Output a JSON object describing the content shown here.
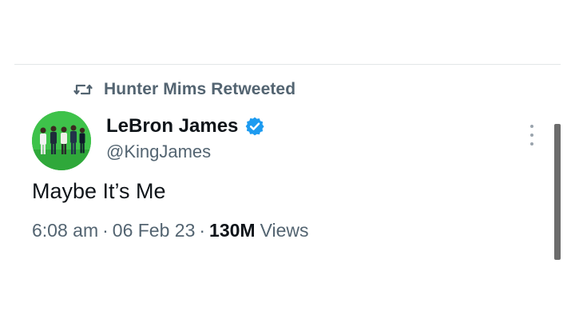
{
  "retweet": {
    "icon": "retweet-icon",
    "text": "Hunter Mims Retweeted"
  },
  "author": {
    "name": "LeBron James",
    "handle": "@KingJames",
    "verified": true,
    "verified_icon": "verified-badge-icon",
    "verified_color": "#1d9bf0",
    "avatar": "avatar-image"
  },
  "tweet": {
    "text": "Maybe It’s Me",
    "time": "6:08 am",
    "date": "06 Feb 23",
    "views_count": "130M",
    "views_label": "Views",
    "separator": "·"
  },
  "more_icon": "more-vertical-icon",
  "colors": {
    "text_primary": "#0f1419",
    "text_secondary": "#536471",
    "divider": "#e3e6e8",
    "avatar_bg": "#3ec24a"
  }
}
